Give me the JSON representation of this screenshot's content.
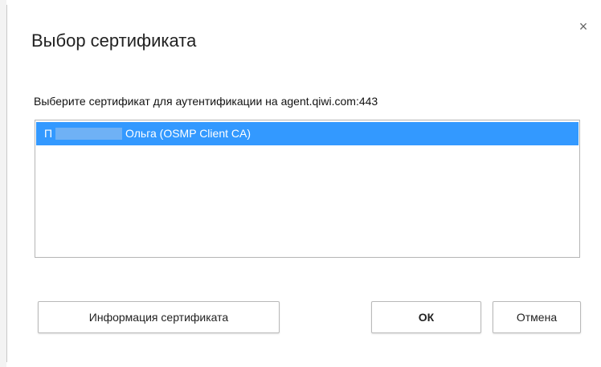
{
  "dialog": {
    "title": "Выбор сертификата",
    "close_label": "×",
    "prompt": "Выберите сертификат для аутентификации на agent.qiwi.com:443"
  },
  "certificates": [
    {
      "initial": "П",
      "name": "Ольга (OSMP Client CA)",
      "selected": true
    }
  ],
  "buttons": {
    "info_label": "Информация сертификата",
    "ok_label": "ОК",
    "cancel_label": "Отмена"
  },
  "colors": {
    "selection": "#3399ff",
    "redaction": "#6fb1f5",
    "border": "#b5b5b5"
  }
}
